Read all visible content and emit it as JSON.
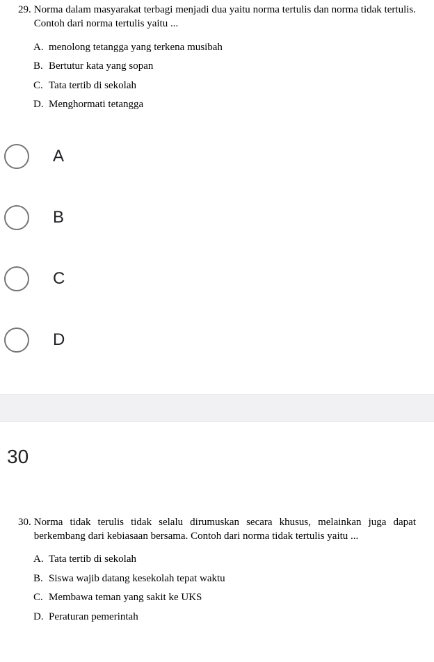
{
  "q29": {
    "number": "29.",
    "text": "Norma dalam masyarakat terbagi menjadi dua yaitu norma tertulis dan norma tidak tertulis. Contoh dari norma tertulis yaitu ...",
    "options": [
      {
        "letter": "A.",
        "text": "menolong tetangga yang terkena musibah"
      },
      {
        "letter": "B.",
        "text": "Bertutur kata yang sopan"
      },
      {
        "letter": "C.",
        "text": "Tata tertib di sekolah"
      },
      {
        "letter": "D.",
        "text": "Menghormati tetangga"
      }
    ]
  },
  "radios": [
    "A",
    "B",
    "C",
    "D"
  ],
  "section_number": "30",
  "q30": {
    "number": "30.",
    "text": "Norma tidak terulis tidak selalu dirumuskan secara khusus, melainkan juga dapat berkembang dari kebiasaan bersama. Contoh dari norma tidak tertulis yaitu ...",
    "options": [
      {
        "letter": "A.",
        "text": "Tata tertib di sekolah"
      },
      {
        "letter": "B.",
        "text": "Siswa wajib datang kesekolah tepat waktu"
      },
      {
        "letter": "C.",
        "text": "Membawa teman yang sakit ke UKS"
      },
      {
        "letter": "D.",
        "text": "Peraturan pemerintah"
      }
    ]
  }
}
